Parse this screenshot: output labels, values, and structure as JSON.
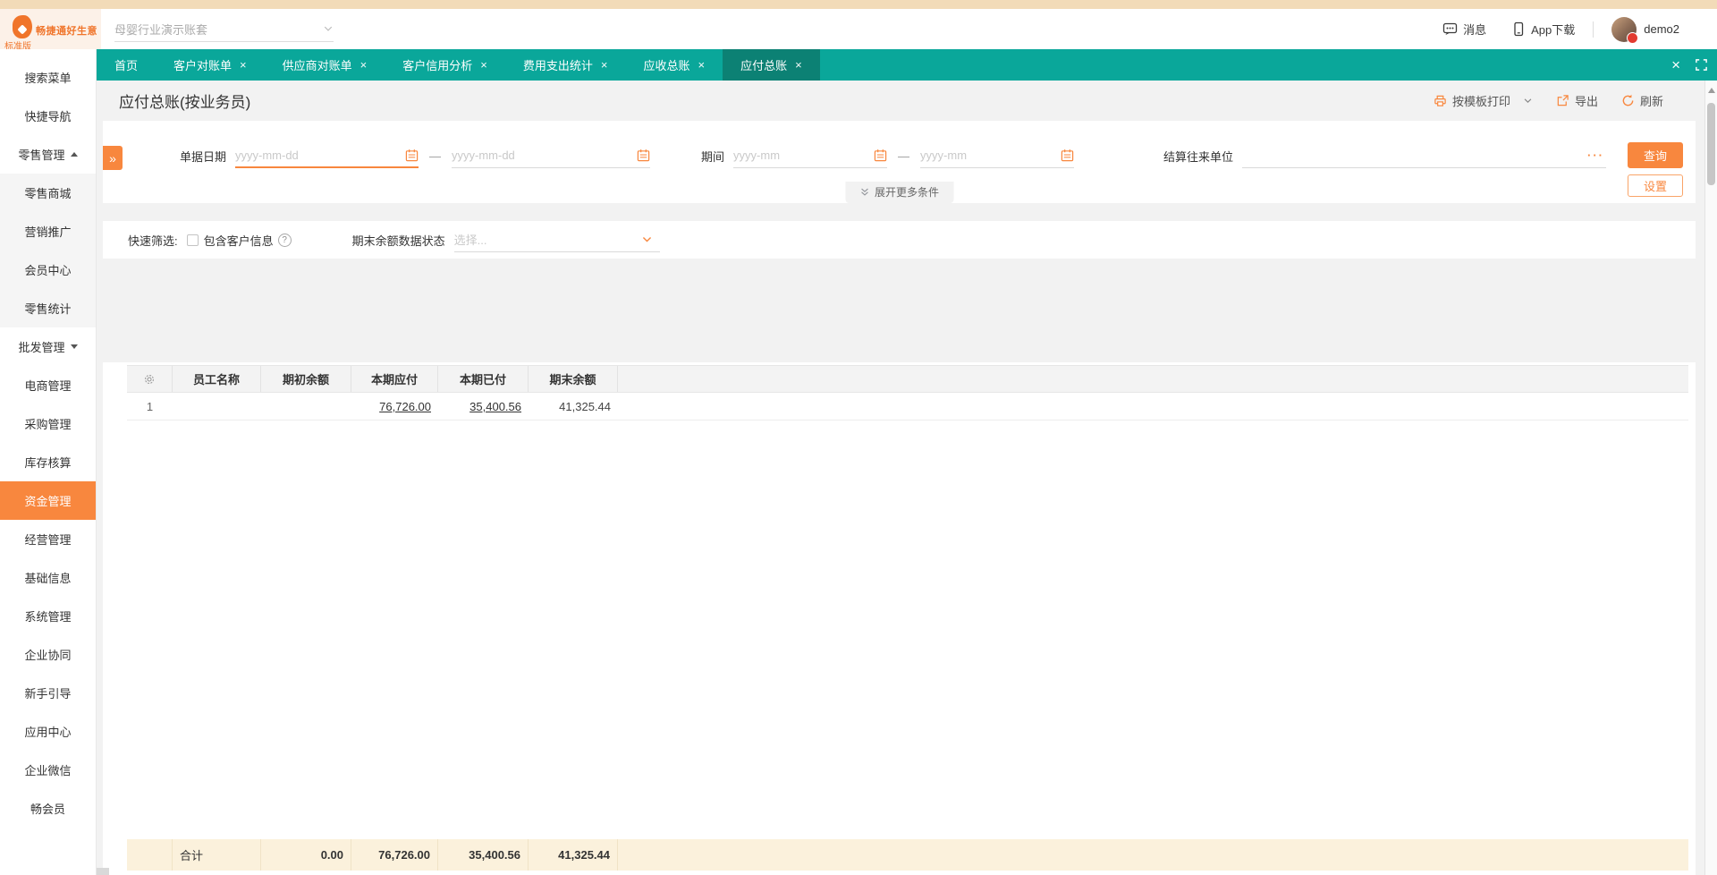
{
  "colors": {
    "accent": "#F8873E",
    "teal": "#0AA79A",
    "teal_active": "#0C8174",
    "total_row_bg": "#FBF1DC"
  },
  "header": {
    "brand": "畅捷通好生意",
    "edition": "标准版",
    "account": "母婴行业演示账套",
    "messages": "消息",
    "app_download": "App下载",
    "username": "demo2"
  },
  "tabs": [
    {
      "label": "首页"
    },
    {
      "label": "客户对账单"
    },
    {
      "label": "供应商对账单"
    },
    {
      "label": "客户信用分析"
    },
    {
      "label": "费用支出统计"
    },
    {
      "label": "应收总账"
    },
    {
      "label": "应付总账"
    }
  ],
  "sidebar": [
    {
      "label": "搜索菜单"
    },
    {
      "label": "快捷导航"
    },
    {
      "label": "零售管理"
    },
    {
      "label": "零售商城"
    },
    {
      "label": "营销推广"
    },
    {
      "label": "会员中心"
    },
    {
      "label": "零售统计"
    },
    {
      "label": "批发管理"
    },
    {
      "label": "电商管理"
    },
    {
      "label": "采购管理"
    },
    {
      "label": "库存核算"
    },
    {
      "label": "资金管理"
    },
    {
      "label": "经营管理"
    },
    {
      "label": "基础信息"
    },
    {
      "label": "系统管理"
    },
    {
      "label": "企业协同"
    },
    {
      "label": "新手引导"
    },
    {
      "label": "应用中心"
    },
    {
      "label": "企业微信"
    },
    {
      "label": "畅会员"
    }
  ],
  "page": {
    "title": "应付总账(按业务员)",
    "toolbar": {
      "print": "按模板打印",
      "export": "导出",
      "refresh": "刷新"
    }
  },
  "filters": {
    "doc_date_label": "单据日期",
    "doc_date_from_placeholder": "yyyy-mm-dd",
    "doc_date_to_placeholder": "yyyy-mm-dd",
    "period_label": "期间",
    "period_from_placeholder": "yyyy-mm",
    "period_to_placeholder": "yyyy-mm",
    "partner_label": "结算往来单位",
    "search_button": "查询",
    "settings_button": "设置",
    "expand_more": "展开更多条件"
  },
  "quick": {
    "quick_filter_label": "快速筛选:",
    "include_customer_label": "包含客户信息",
    "help_glyph": "?",
    "balance_status_label": "期末余额数据状态",
    "balance_status_placeholder": "选择..."
  },
  "table": {
    "columns": [
      "员工名称",
      "期初余额",
      "本期应付",
      "本期已付",
      "期末余额"
    ],
    "rows": [
      {
        "index": "1",
        "name": "",
        "opening": "",
        "payable": "76,726.00",
        "paid": "35,400.56",
        "ending": "41,325.44"
      }
    ],
    "total": {
      "label": "合计",
      "opening": "0.00",
      "payable": "76,726.00",
      "paid": "35,400.56",
      "ending": "41,325.44"
    }
  },
  "glyphs": {
    "collapse": "»",
    "dash": "—",
    "ellipsis": "···",
    "close": "×"
  }
}
